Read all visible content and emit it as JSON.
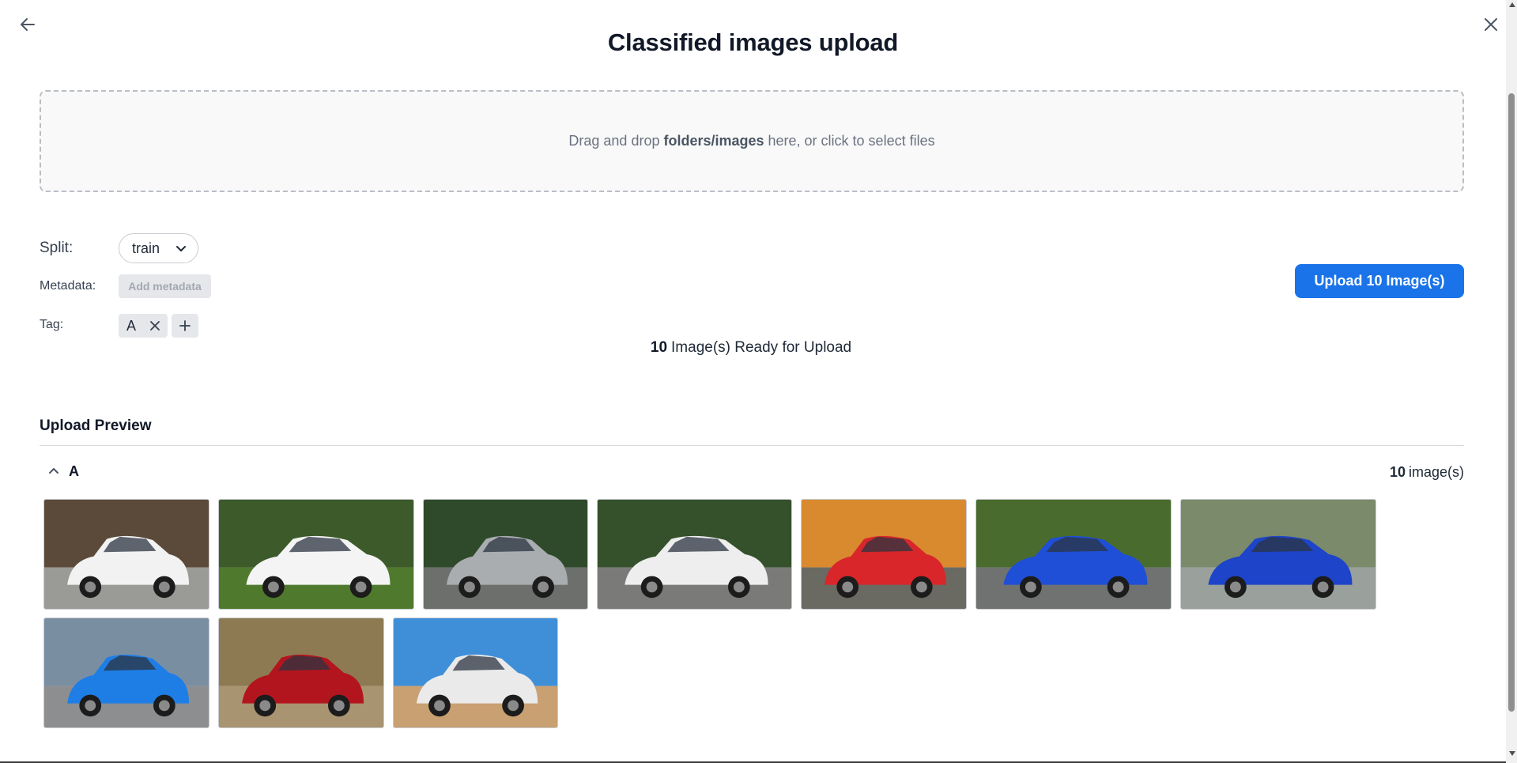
{
  "dialog": {
    "title": "Classified images upload"
  },
  "dropzone": {
    "text_before": "Drag and drop",
    "text_bold": "folders/images",
    "text_after": "here, or click to select files"
  },
  "form": {
    "split_label": "Split:",
    "split_value": "train",
    "metadata_label": "Metadata:",
    "metadata_button": "Add metadata",
    "tag_label": "Tag:",
    "tags": [
      "A"
    ]
  },
  "status": {
    "ready_count": "10",
    "ready_text": "Image(s) Ready for Upload"
  },
  "upload_button": "Upload 10 Image(s)",
  "preview": {
    "title": "Upload Preview",
    "group": {
      "name": "A",
      "count": "10",
      "count_label": "image(s)",
      "images": [
        {
          "subject": "white SUV in front of pallets",
          "colors": {
            "sky": "#5b4a3a",
            "ground": "#9a9a96",
            "car": "#f2f2f2"
          }
        },
        {
          "subject": "white sedan on grass",
          "colors": {
            "sky": "#3d5a2a",
            "ground": "#4f7a2e",
            "car": "#f4f4f4"
          }
        },
        {
          "subject": "silver sports car front",
          "colors": {
            "sky": "#2f4a2a",
            "ground": "#6c6f6b",
            "car": "#a9adb0"
          }
        },
        {
          "subject": "white crossover",
          "colors": {
            "sky": "#35512c",
            "ground": "#7a7b78",
            "car": "#eeeeee"
          }
        },
        {
          "subject": "red convertible at sunset",
          "colors": {
            "sky": "#d98a2e",
            "ground": "#6a6a62",
            "car": "#d8262a"
          }
        },
        {
          "subject": "blue sedan front",
          "colors": {
            "sky": "#4a6b2e",
            "ground": "#6f7270",
            "car": "#1f4fd6"
          }
        },
        {
          "subject": "blue coupe side",
          "colors": {
            "sky": "#7a8a6a",
            "ground": "#9aa09c",
            "car": "#1d44c9"
          }
        },
        {
          "subject": "blue hatchback",
          "colors": {
            "sky": "#7a8ea2",
            "ground": "#8c8e90",
            "car": "#1e7ee6"
          }
        },
        {
          "subject": "red sports car on road",
          "colors": {
            "sky": "#8d7a52",
            "ground": "#a89470",
            "car": "#b3151f"
          }
        },
        {
          "subject": "white car drifting on sand",
          "colors": {
            "sky": "#3f8fd8",
            "ground": "#c9a072",
            "car": "#eaeaea"
          }
        }
      ]
    }
  },
  "icons": {
    "back": "arrow-left-icon",
    "close": "close-icon",
    "select_caret": "chevron-down-icon",
    "tag_remove": "close-icon",
    "tag_add": "plus-icon",
    "group_toggle": "chevron-up-icon"
  },
  "colors": {
    "accent": "#1a73e8",
    "chip_bg": "#e5e7eb",
    "dropzone_border": "#b9bec6"
  }
}
